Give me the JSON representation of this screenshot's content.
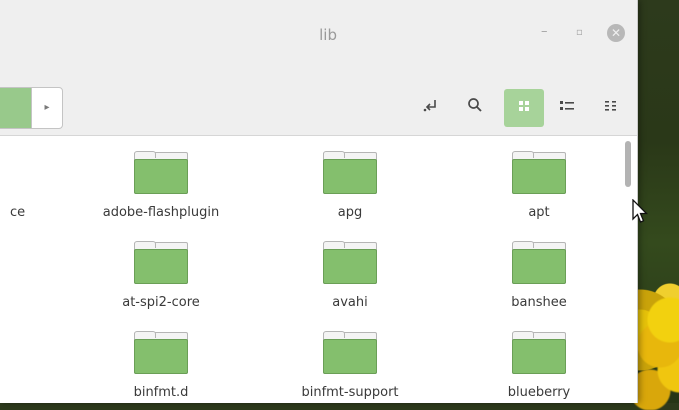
{
  "window": {
    "title": "lib"
  },
  "window_controls": {
    "minimize": "–",
    "maximize": "▫",
    "close": "✕"
  },
  "toolbar": {
    "path_next": "▸",
    "icons": [
      "jump-to-icon",
      "search-icon",
      "icon-view-icon",
      "list-view-icon",
      "compact-view-icon"
    ]
  },
  "files": {
    "partial_label": "ce",
    "items": [
      {
        "name": "adobe-flashplugin"
      },
      {
        "name": "apg"
      },
      {
        "name": "apt"
      },
      {
        "name": "at-spi2-core"
      },
      {
        "name": "avahi"
      },
      {
        "name": "banshee"
      },
      {
        "name": "binfmt.d"
      },
      {
        "name": "binfmt-support"
      },
      {
        "name": "blueberry"
      }
    ]
  },
  "colors": {
    "accent": "#a7d39a",
    "folder": "#84bf6d"
  }
}
